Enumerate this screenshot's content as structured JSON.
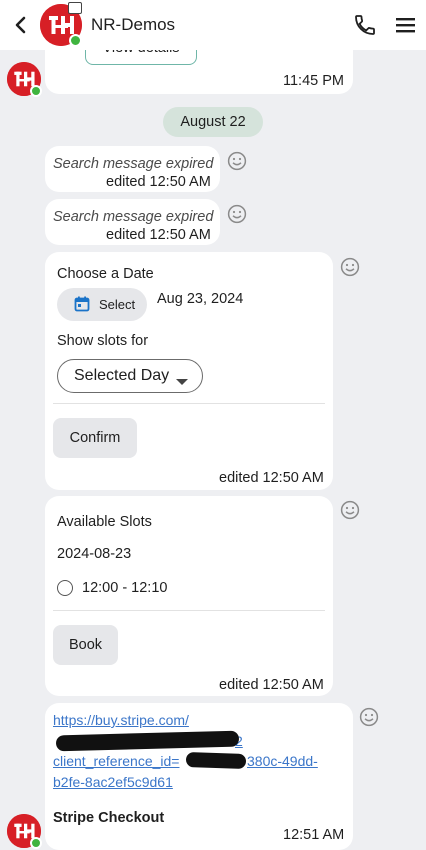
{
  "header": {
    "title": "NR-Demos",
    "icons": [
      "back-arrow-icon",
      "phone-icon",
      "menu-icon"
    ]
  },
  "messages": {
    "first": {
      "button": "View details",
      "time": "11:45 PM"
    },
    "date_chip": "August 22",
    "expired1": {
      "text": "Search message expired",
      "meta": "edited 12:50 AM"
    },
    "expired2": {
      "text": "Search message expired",
      "meta": "edited 12:50 AM"
    },
    "date_form": {
      "choose_label": "Choose a Date",
      "select_label": "Select",
      "selected_date": "Aug 23, 2024",
      "show_slots_label": "Show slots for",
      "dropdown_value": "Selected Day",
      "confirm_label": "Confirm",
      "meta": "edited 12:50 AM"
    },
    "slots": {
      "title": "Available Slots",
      "date": "2024-08-23",
      "slot_label": "12:00 - 12:10",
      "book_label": "Book",
      "meta": "edited 12:50 AM"
    },
    "stripe": {
      "link_line1": "https://buy.stripe.com/",
      "link_line2_visible": "2",
      "link_line3_prefix": "client_reference_id=",
      "link_line3_suffix": "380c-49dd-",
      "link_line4": "b2fe-8ac2ef5c9d61",
      "title": "Stripe Checkout",
      "time": "12:51 AM"
    }
  },
  "colors": {
    "brand_red": "#d71f26",
    "online_green": "#3fb43f",
    "date_chip": "#d5e3db",
    "link": "#3b76c9",
    "calendar_blue": "#1a73c8"
  }
}
